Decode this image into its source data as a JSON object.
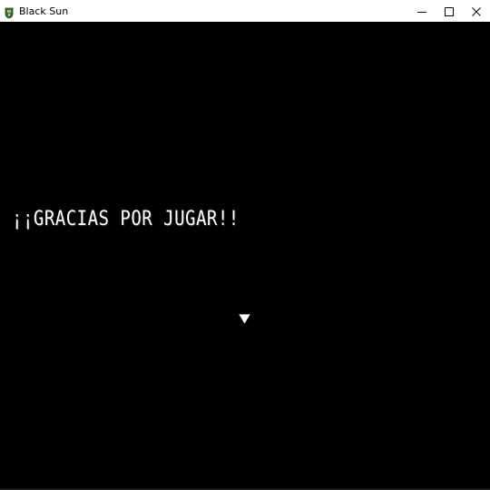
{
  "window": {
    "title": "Black Sun",
    "app_icon": "game-app-icon",
    "controls": {
      "minimize_icon": "minimize-icon",
      "maximize_icon": "maximize-icon",
      "close_icon": "close-icon"
    }
  },
  "game": {
    "message": "¡¡GRACIAS POR JUGAR!!",
    "continue_icon": "down-triangle-icon",
    "background_color": "#000000",
    "text_color": "#ffffff"
  }
}
